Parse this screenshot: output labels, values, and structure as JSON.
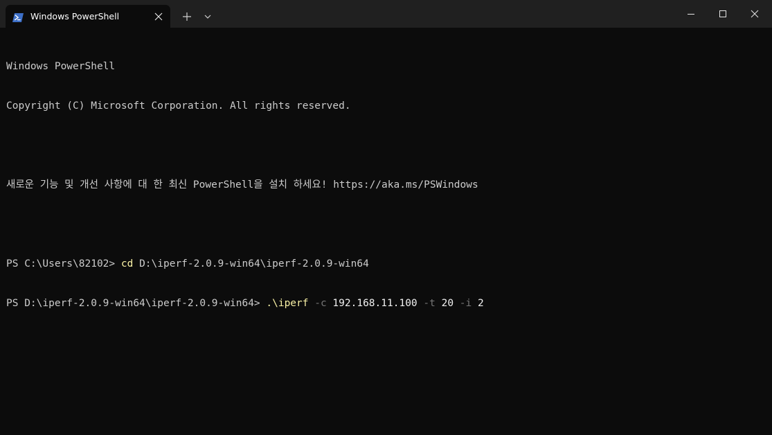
{
  "tab": {
    "title": "Windows PowerShell",
    "icon": "powershell-icon"
  },
  "titlebar": {
    "new_tab_icon": "plus-icon",
    "dropdown_icon": "chevron-down-icon",
    "minimize_icon": "minimize-icon",
    "maximize_icon": "maximize-icon",
    "close_icon": "close-icon"
  },
  "colors": {
    "background": "#0c0c0c",
    "titlebar": "#202020",
    "text": "#cccccc",
    "command": "#f9f1a5",
    "parameter": "#767676"
  },
  "terminal": {
    "banner_title": "Windows PowerShell",
    "copyright": "Copyright (C) Microsoft Corporation. All rights reserved.",
    "update_notice": "새로운 기능 및 개선 사항에 대 한 최신 PowerShell을 설치 하세요! https://aka.ms/PSWindows",
    "line1": {
      "prompt": "PS C:\\Users\\82102> ",
      "command": "cd",
      "argument": " D:\\iperf-2.0.9-win64\\iperf-2.0.9-win64"
    },
    "line2": {
      "prompt": "PS D:\\iperf-2.0.9-win64\\iperf-2.0.9-win64> ",
      "command": ".\\iperf",
      "flag_c": " -c",
      "host": " 192.168.11.100",
      "flag_t": " -t",
      "duration": " 20",
      "flag_i": " -i",
      "interval": " 2"
    }
  }
}
